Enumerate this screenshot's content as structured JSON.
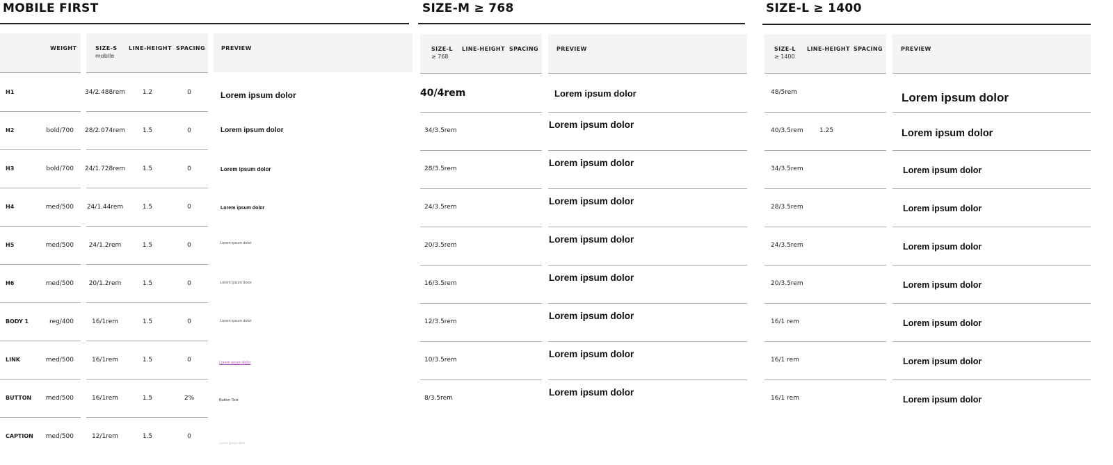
{
  "mobile": {
    "title": "MOBILE FIRST",
    "headers": {
      "weight": "WEIGHT",
      "size": "SIZE-S",
      "size_sub": "mobile",
      "lineheight": "LINE-HEIGHT",
      "spacing": "SPACING",
      "preview": "PREVIEW"
    },
    "rows": [
      {
        "label": "H1",
        "weight": "",
        "size": "34/2.488rem",
        "lh": "1.2",
        "spacing": "0",
        "preview": "Lorem ipsum dolor"
      },
      {
        "label": "H2",
        "weight": "bold/700",
        "size": "28/2.074rem",
        "lh": "1.5",
        "spacing": "0",
        "preview": "Lorem ipsum dolor"
      },
      {
        "label": "H3",
        "weight": "bold/700",
        "size": "24/1.728rem",
        "lh": "1.5",
        "spacing": "0",
        "preview": "Lorem ipsum dolor"
      },
      {
        "label": "H4",
        "weight": "med/500",
        "size": "24/1.44rem",
        "lh": "1.5",
        "spacing": "0",
        "preview": "Lorem ipsum dolor"
      },
      {
        "label": "H5",
        "weight": "med/500",
        "size": "24/1.2rem",
        "lh": "1.5",
        "spacing": "0",
        "preview": "Lorem ipsum dolor"
      },
      {
        "label": "H6",
        "weight": "med/500",
        "size": "20/1.2rem",
        "lh": "1.5",
        "spacing": "0",
        "preview": "Lorem ipsum dolor"
      },
      {
        "label": "BODY 1",
        "weight": "reg/400",
        "size": "16/1rem",
        "lh": "1.5",
        "spacing": "0",
        "preview": "Lorem ipsum dolor"
      },
      {
        "label": "LINK",
        "weight": "med/500",
        "size": "16/1rem",
        "lh": "1.5",
        "spacing": "0",
        "preview": "Lorem ipsum dolor"
      },
      {
        "label": "BUTTON",
        "weight": "med/500",
        "size": "16/1rem",
        "lh": "1.5",
        "spacing": "2%",
        "preview": "Button Text"
      },
      {
        "label": "CAPTION",
        "weight": "med/500",
        "size": "12/1rem",
        "lh": "1.5",
        "spacing": "0",
        "preview": "Lorem ipsum dolor"
      }
    ]
  },
  "sizem": {
    "title": "SIZE-M ≥ 768",
    "headers": {
      "size": "SIZE-L",
      "size_sub": "≥ 768",
      "lineheight": "LINE-HEIGHT",
      "spacing": "SPACING",
      "preview": "PREVIEW"
    },
    "rows": [
      {
        "size": "40/4rem",
        "preview": "Lorem ipsum dolor"
      },
      {
        "size": "34/3.5rem",
        "preview": "Lorem ipsum dolor"
      },
      {
        "size": "28/3.5rem",
        "preview": "Lorem ipsum dolor"
      },
      {
        "size": "24/3.5rem",
        "preview": "Lorem ipsum dolor"
      },
      {
        "size": "20/3.5rem",
        "preview": "Lorem ipsum dolor"
      },
      {
        "size": "16/3.5rem",
        "preview": "Lorem ipsum dolor"
      },
      {
        "size": "12/3.5rem",
        "preview": "Lorem ipsum dolor"
      },
      {
        "size": "10/3.5rem",
        "preview": "Lorem ipsum dolor"
      },
      {
        "size": "8/3.5rem",
        "preview": "Lorem ipsum dolor"
      }
    ]
  },
  "sizel": {
    "title": "SIZE-L ≥ 1400",
    "headers": {
      "size": "SIZE-L",
      "size_sub": "≥ 1400",
      "lineheight": "LINE-HEIGHT",
      "spacing": "SPACING",
      "preview": "PREVIEW"
    },
    "rows": [
      {
        "size": "48/5rem",
        "lh": "",
        "preview": "Lorem ipsum dolor"
      },
      {
        "size": "40/3.5rem",
        "lh": "1.25",
        "preview": "Lorem ipsum dolor"
      },
      {
        "size": "34/3.5rem",
        "lh": "",
        "preview": "Lorem ipsum dolor"
      },
      {
        "size": "28/3.5rem",
        "lh": "",
        "preview": "Lorem ipsum dolor"
      },
      {
        "size": "24/3.5rem",
        "lh": "",
        "preview": "Lorem ipsum dolor"
      },
      {
        "size": "20/3.5rem",
        "lh": "",
        "preview": "Lorem ipsum dolor"
      },
      {
        "size": "16/1 rem",
        "lh": "",
        "preview": "Lorem ipsum dolor"
      },
      {
        "size": "16/1 rem",
        "lh": "",
        "preview": "Lorem ipsum dolor"
      },
      {
        "size": "16/1 rem",
        "lh": "",
        "preview": "Lorem ipsum dolor"
      }
    ]
  },
  "colors": {
    "link": "#b04fc0",
    "header_bg": "#f4f4f4",
    "rule": "#222222",
    "divider": "#a8a8a8"
  }
}
